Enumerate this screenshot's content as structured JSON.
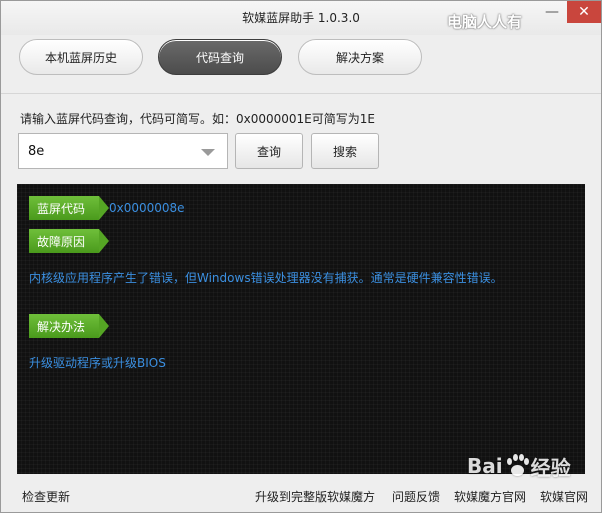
{
  "window": {
    "title": "软媒蓝屏助手 1.0.3.0",
    "watermark": "电脑人人有",
    "minimize_glyph": "—",
    "close_glyph": "✕"
  },
  "tabs": [
    {
      "label": "本机蓝屏历史",
      "active": false
    },
    {
      "label": "代码查询",
      "active": true
    },
    {
      "label": "解决方案",
      "active": false
    }
  ],
  "query": {
    "hint": "请输入蓝屏代码查询，代码可简写。如：0x0000001E可简写为1E",
    "value": "8e",
    "query_button": "查询",
    "search_button": "搜索"
  },
  "result": {
    "code_tag": "蓝屏代码",
    "code_value": "0x0000008e",
    "cause_tag": "故障原因",
    "cause_text": "内核级应用程序产生了错误，但Windows错误处理器没有捕获。通常是硬件兼容性错误。",
    "solution_tag": "解决办法",
    "solution_text": "升级驱动程序或升级BIOS"
  },
  "footer": {
    "check_update": "检查更新",
    "upgrade": "升级到完整版软媒魔方",
    "feedback": "问题反馈",
    "mofang_site": "软媒魔方官网",
    "ruanmei_site": "软媒官网"
  },
  "baidu_watermark": {
    "brand": "Bai",
    "suffix": "经验"
  },
  "colors": {
    "accent_green": "#4a9a1c",
    "result_text_blue": "#3b8fe0",
    "console_bg": "#111111",
    "active_tab": "#555555",
    "close_button": "#c9463d"
  }
}
